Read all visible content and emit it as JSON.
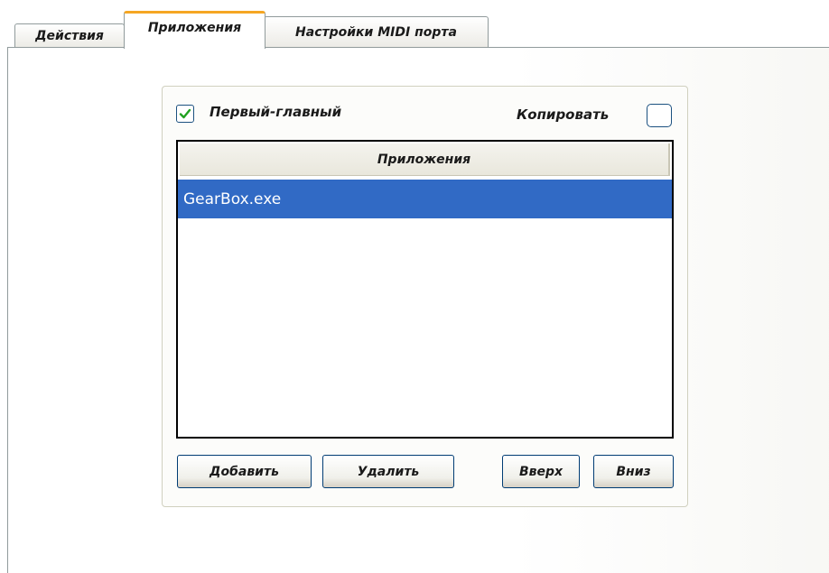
{
  "tabs": [
    {
      "label": "Действия",
      "active": false
    },
    {
      "label": "Приложения",
      "active": true
    },
    {
      "label": "Настройки MIDI порта",
      "active": false
    }
  ],
  "options": {
    "first_main_label": "Первый-главный",
    "first_main_checked": true,
    "copy_label": "Копировать",
    "copy_checked": false
  },
  "list": {
    "header": "Приложения",
    "items": [
      "GearBox.exe"
    ],
    "selected_index": 0
  },
  "buttons": {
    "add": "Добавить",
    "remove": "Удалить",
    "up": "Вверх",
    "down": "Вниз"
  },
  "colors": {
    "selection": "#316ac5",
    "active_tab_accent": "#f5a623",
    "check_mark": "#21a121"
  }
}
